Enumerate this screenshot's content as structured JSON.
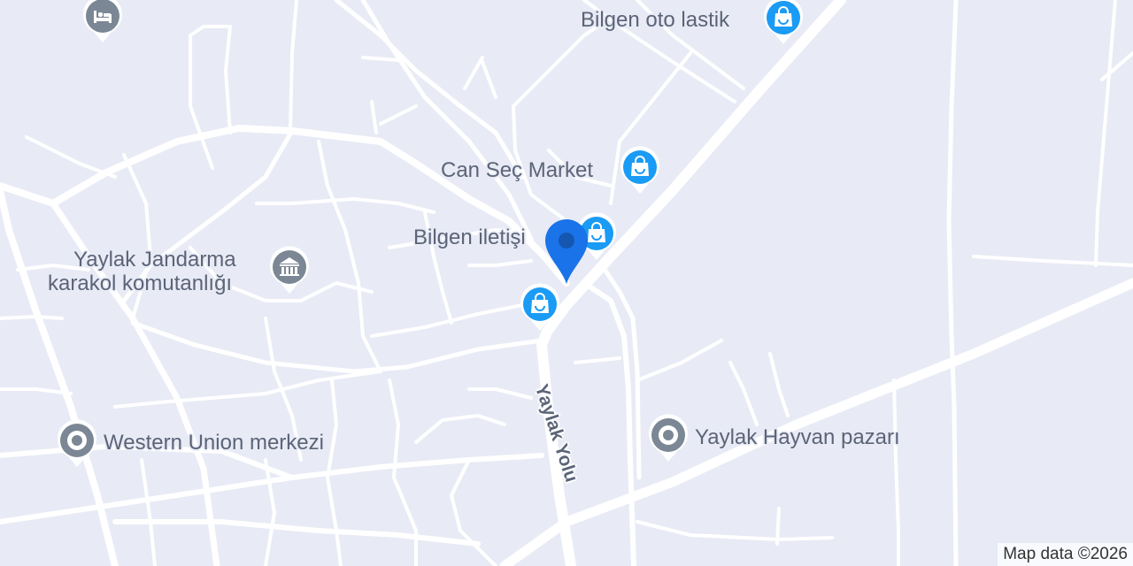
{
  "map": {
    "street_label": "Yaylak Yolu",
    "attribution": "Map data ©2026",
    "colors": {
      "background": "#e8ebf5",
      "road": "#ffffff",
      "label_text": "#5b6478",
      "shop_pin": "#1a9bf5",
      "poi_pin": "#7b8794",
      "user_location": "#1a73e8"
    }
  },
  "places": {
    "bilgen_oto": {
      "name": "Bilgen oto lastik",
      "icon": "shopping-bag-icon"
    },
    "can_sec": {
      "name": "Can Seç Market",
      "icon": "shopping-bag-icon"
    },
    "bilgen_iletisim": {
      "name": "Bilgen iletişi",
      "icon": "shopping-bag-icon"
    },
    "jandarma": {
      "name": "Yaylak Jandarma karakol komutanlığı",
      "line1": "Yaylak Jandarma",
      "line2": "karakol komutanlığı",
      "icon": "government-building-icon"
    },
    "western_union": {
      "name": "Western Union merkezi",
      "icon": "place-icon"
    },
    "hayvan_pazari": {
      "name": "Yaylak Hayvan pazarı",
      "icon": "place-icon"
    },
    "hotel": {
      "icon": "hotel-bed-icon"
    },
    "unnamed_shop": {
      "icon": "shopping-bag-icon"
    }
  }
}
